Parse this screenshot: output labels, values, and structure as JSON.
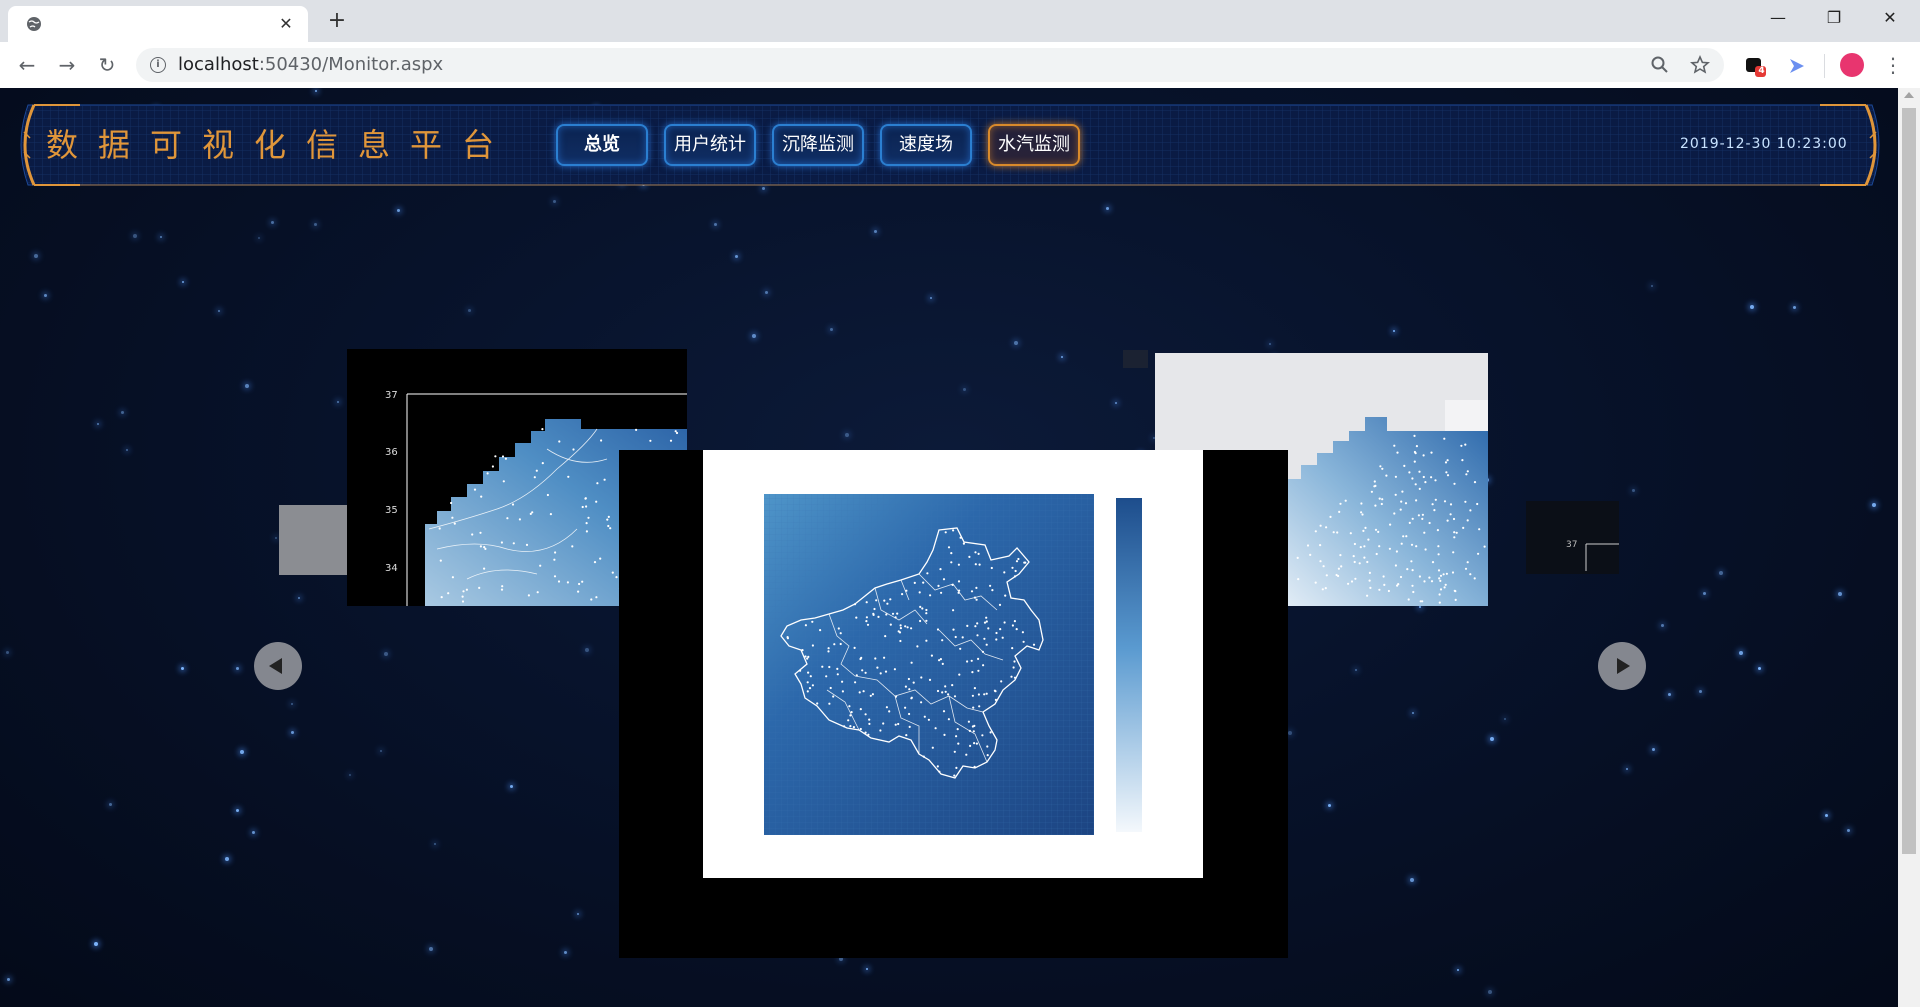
{
  "browser": {
    "tab_close": "✕",
    "new_tab": "+",
    "minimize": "—",
    "restore": "❐",
    "close": "✕",
    "back": "←",
    "forward": "→",
    "reload": "↻",
    "info": "i",
    "url_host": "localhost",
    "url_rest": ":50430/Monitor.aspx",
    "ext_badge": "4",
    "menu": "⋮"
  },
  "header": {
    "title": "数据可视化信息平台",
    "tabs": [
      {
        "label": "总览"
      },
      {
        "label": "用户统计"
      },
      {
        "label": "沉降监测"
      },
      {
        "label": "速度场"
      },
      {
        "label": "水汽监测"
      }
    ],
    "datetime": "2019-12-30  10:23:00"
  },
  "slides": {
    "left_ticks": [
      "37",
      "36",
      "35",
      "34"
    ],
    "right_tick": "37"
  },
  "colors": {
    "title": "#e0963a",
    "nav_border_blue": "#2b7fd1",
    "nav_border_orange": "#d98a2b",
    "heatmap_dark": "#1d4d8c",
    "heatmap_light": "#4f95c9"
  },
  "icons": {
    "globe": "globe-icon",
    "search": "search-icon",
    "bookmark": "star-icon",
    "carousel_prev": "play-left-icon",
    "carousel_next": "play-right-icon"
  }
}
